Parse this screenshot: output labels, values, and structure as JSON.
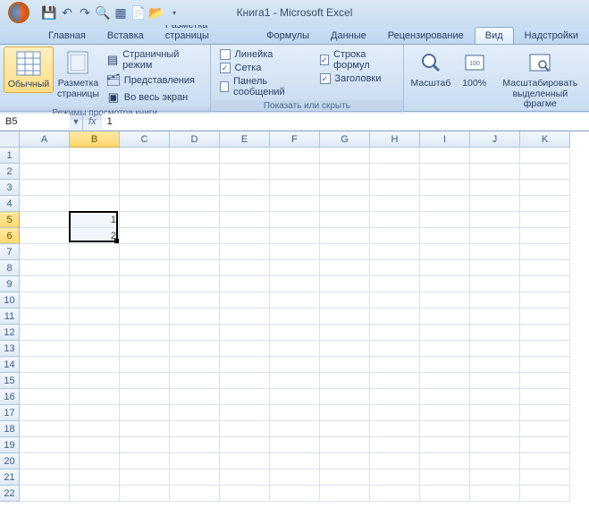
{
  "title": "Книга1 - Microsoft Excel",
  "tabs": [
    {
      "label": "Главная"
    },
    {
      "label": "Вставка"
    },
    {
      "label": "Разметка страницы"
    },
    {
      "label": "Формулы"
    },
    {
      "label": "Данные"
    },
    {
      "label": "Рецензирование"
    },
    {
      "label": "Вид",
      "active": true
    },
    {
      "label": "Надстройки"
    }
  ],
  "ribbon": {
    "views_group_label": "Режимы просмотра книги",
    "show_group_label": "Показать или скрыть",
    "zoom_group_label": "Масштаб",
    "normal": "Обычный",
    "page_layout": "Разметка\nстраницы",
    "page_break": "Страничный режим",
    "custom_views": "Представления",
    "full_screen": "Во весь экран",
    "ruler": "Линейка",
    "gridlines": "Сетка",
    "message_bar": "Панель сообщений",
    "formula_bar": "Строка формул",
    "headings": "Заголовки",
    "zoom": "Масштаб",
    "zoom100": "100%",
    "zoom_sel": "Масштабировать\nвыделенный фрагме"
  },
  "name_box": "B5",
  "formula": "1",
  "columns": [
    "A",
    "B",
    "C",
    "D",
    "E",
    "F",
    "G",
    "H",
    "I",
    "J",
    "K"
  ],
  "rows": [
    "1",
    "2",
    "3",
    "4",
    "5",
    "6",
    "7",
    "8",
    "9",
    "10",
    "11",
    "12",
    "13",
    "14",
    "15",
    "16",
    "17",
    "18",
    "19",
    "20",
    "21",
    "22"
  ],
  "cell_b5": "1",
  "cell_b6": "2",
  "selection": {
    "col_start": 1,
    "row_start": 4,
    "cols": 1,
    "rows": 2
  }
}
